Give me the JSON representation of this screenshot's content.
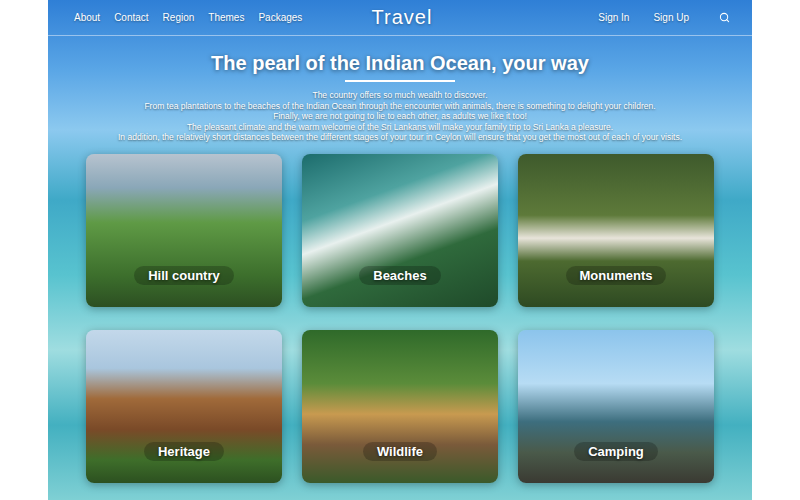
{
  "nav": {
    "left_links": [
      "About",
      "Contact",
      "Region",
      "Themes",
      "Packages"
    ],
    "logo": "Travel",
    "right_links": [
      "Sign In",
      "Sign Up"
    ]
  },
  "hero": {
    "title": "The pearl of the Indian Ocean, your way",
    "paragraph": [
      "The country offers so much wealth to discover.",
      "From tea plantations to the beaches of the Indian Ocean through the encounter with animals, there is something to delight your children.",
      "Finally, we are not going to lie to each other, as adults we like it too!",
      "The pleasant climate and the warm welcome of the Sri Lankans will make your family trip to Sri Lanka a pleasure.",
      "In addition, the relatively short distances between the different stages of your tour in Ceylon will ensure that you get the most out of each of your visits."
    ]
  },
  "cards": [
    {
      "label": "Hill country"
    },
    {
      "label": "Beaches"
    },
    {
      "label": "Monuments"
    },
    {
      "label": "Heritage"
    },
    {
      "label": "Wildlife"
    },
    {
      "label": "Camping"
    }
  ]
}
